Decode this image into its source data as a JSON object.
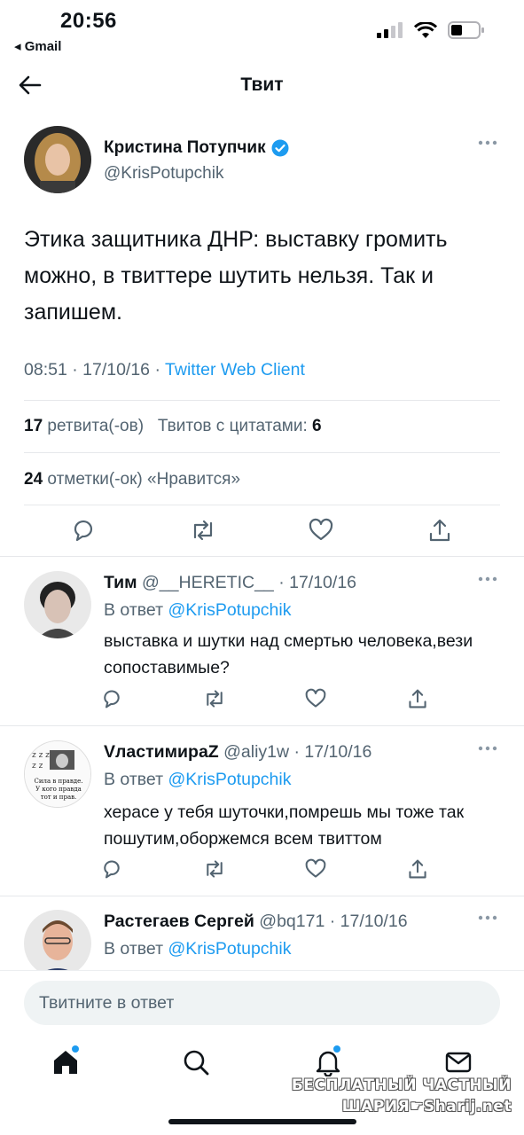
{
  "status_bar": {
    "time": "20:56",
    "back_app": "◂ Gmail"
  },
  "header": {
    "title": "Твит"
  },
  "tweet": {
    "author_name": "Кристина Потупчик",
    "handle": "@KrisPotupchik",
    "text": "Этика защитника ДНР: выставку громить можно, в твиттере шутить нельзя. Так и запишем.",
    "time": "08:51 · 17/10/16 ·",
    "client": "Twitter Web Client",
    "retweets_count": "17",
    "retweets_label": "ретвита(-ов)",
    "quotes_label": "Твитов с цитатами:",
    "quotes_count": "6",
    "likes_count": "24",
    "likes_label": "отметки(-ок) «Нравится»"
  },
  "replies": [
    {
      "name": "Тим",
      "meta": "@__HERETIC__ · 17/10/16",
      "in_reply_label": "В ответ",
      "in_reply_handle": "@KrisPotupchik",
      "text": "выставка и шутки над смертью человека,вези сопоставимые?"
    },
    {
      "name": "VластимираZ",
      "meta": "@aliy1w · 17/10/16",
      "in_reply_label": "В ответ",
      "in_reply_handle": "@KrisPotupchik",
      "text": "херасе у тебя шуточки,помрешь мы тоже так пошутим,оборжемся всем твиттом",
      "avatar_caption": "Сила в правде. У кого правда тот и прав."
    },
    {
      "name": "Растегаев Сергей",
      "meta": "@bq171 · 17/10/16",
      "in_reply_label": "В ответ",
      "in_reply_handle": "@KrisPotupchik",
      "text": ""
    }
  ],
  "composer": {
    "placeholder": "Твитните в ответ"
  },
  "tabs": [
    "home-icon",
    "search-icon",
    "notifications-icon",
    "messages-icon"
  ],
  "watermark": {
    "line1": "БЕСПЛАТНЫЙ ЧАСТНЫЙ",
    "line2": "ШАРИЯ☛Sharij.net"
  },
  "colors": {
    "accent": "#1d9bf0",
    "text": "#0f1419",
    "secondary": "#536471",
    "divider": "#e6e8eb"
  }
}
